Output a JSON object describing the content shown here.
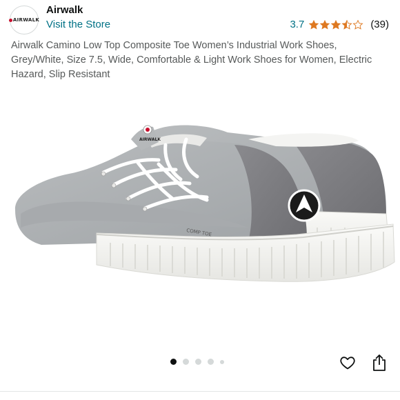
{
  "brand": {
    "name": "Airwalk",
    "logo_text": "AIRWALK",
    "visit_store_label": "Visit the Store"
  },
  "rating": {
    "score": "3.7",
    "stars_value": 3.7,
    "stars_max": 5,
    "review_count": "(39)"
  },
  "product": {
    "title": "Airwalk Camino Low Top Composite Toe Women’s Industrial Work Shoes, Grey/White, Size 7.5, Wide, Comfortable & Light Work Shoes for Women, Electric Hazard, Slip Resistant",
    "image_icon": "product-photo",
    "shoe_print_text": "COMP TOE",
    "tongue_label": "AIRWALK"
  },
  "carousel": {
    "total_images": 5,
    "active_index": 0
  },
  "actions": {
    "wishlist_icon": "heart-icon",
    "share_icon": "share-icon"
  },
  "colors": {
    "link": "#007185",
    "star": "#de7921",
    "text": "#0f1111",
    "secondary_text": "#565959"
  }
}
